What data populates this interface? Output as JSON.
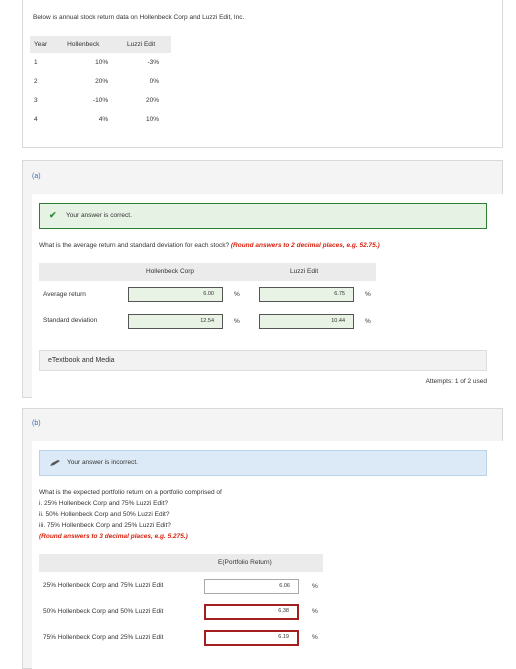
{
  "intro_text": "Below is annual stock return data on Hollenbeck Corp and Luzzi Edit, Inc.",
  "stock_table": {
    "headers": [
      "Year",
      "Hollenbeck",
      "Luzzi Edit"
    ],
    "rows": [
      [
        "1",
        "10%",
        "-3%"
      ],
      [
        "2",
        "20%",
        "0%"
      ],
      [
        "3",
        "-10%",
        "20%"
      ],
      [
        "4",
        "4%",
        "10%"
      ]
    ]
  },
  "part_a": {
    "label": "(a)",
    "feedback": "Your answer is correct.",
    "question": "What is the average return and standard deviation for each stock?",
    "rounding_note": "(Round answers to 2 decimal places, e.g. 52.75.)",
    "col_headers": [
      "Hollenbeck Corp",
      "Luzzi Edit"
    ],
    "rows": [
      {
        "label": "Average return",
        "hollenbeck": "6.00",
        "luzzi": "6.75",
        "unit": "%"
      },
      {
        "label": "Standard deviation",
        "hollenbeck": "12.54",
        "luzzi": "10.44",
        "unit": "%"
      }
    ],
    "etextbook": "eTextbook and Media",
    "attempts": "Attempts: 1 of 2 used"
  },
  "part_b": {
    "label": "(b)",
    "feedback": "Your answer is incorrect.",
    "question_lines": [
      "What is the expected portfolio return on a portfolio comprised of",
      "i. 25% Hollenbeck Corp and 75% Luzzi Edit?",
      "ii. 50% Hollenbeck Corp and 50% Luzzi Edit?",
      "iii. 75% Hollenbeck Corp and 25% Luzzi Edit?"
    ],
    "rounding_note": "(Round answers to 3 decimal places, e.g. 5.275.)",
    "col_header": "E(Portfolio Return)",
    "rows": [
      {
        "label": "25% Hollenbeck Corp and 75% Luzzi Edit",
        "value": "6.06",
        "unit": "%"
      },
      {
        "label": "50% Hollenbeck Corp and 50% Luzzi Edit",
        "value": "6.38",
        "unit": "%"
      },
      {
        "label": "75% Hollenbeck Corp and 25% Luzzi Edit",
        "value": "6.19",
        "unit": "%"
      }
    ]
  }
}
